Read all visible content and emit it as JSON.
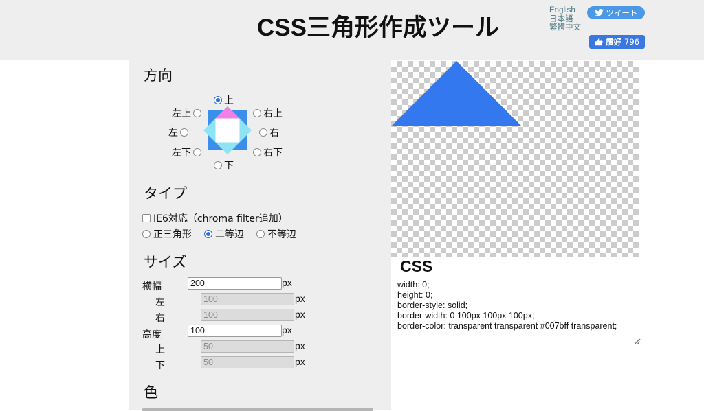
{
  "header": {
    "title": "CSS三角形作成ツール",
    "languages": [
      "English",
      "日本語",
      "繁體中文"
    ],
    "tweet_label": "ツイート",
    "like_label": "讚好",
    "like_count": "796"
  },
  "direction": {
    "title": "方向",
    "options": {
      "top": "上",
      "top_left": "左上",
      "top_right": "右上",
      "left": "左",
      "right": "右",
      "bottom_left": "左下",
      "bottom_right": "右下",
      "bottom": "下"
    },
    "selected": "top"
  },
  "type": {
    "title": "タイプ",
    "ie6_label": "IE6対応（chroma filter追加）",
    "ie6_checked": false,
    "options": [
      "正三角形",
      "二等辺",
      "不等辺"
    ],
    "selected": "二等辺"
  },
  "size": {
    "title": "サイズ",
    "width_label": "横幅",
    "width_value": "200",
    "left_label": "左",
    "left_value": "100",
    "right_label": "右",
    "right_value": "100",
    "height_label": "高度",
    "height_value": "100",
    "top_label": "上",
    "top_value": "50",
    "bottom_label": "下",
    "bottom_value": "50",
    "unit": "px"
  },
  "color": {
    "title": "色",
    "value": "#007bff"
  },
  "output": {
    "title": "CSS",
    "code": "width: 0;\nheight: 0;\nborder-style: solid;\nborder-width: 0 100px 100px 100px;\nborder-color: transparent transparent #007bff transparent;"
  }
}
